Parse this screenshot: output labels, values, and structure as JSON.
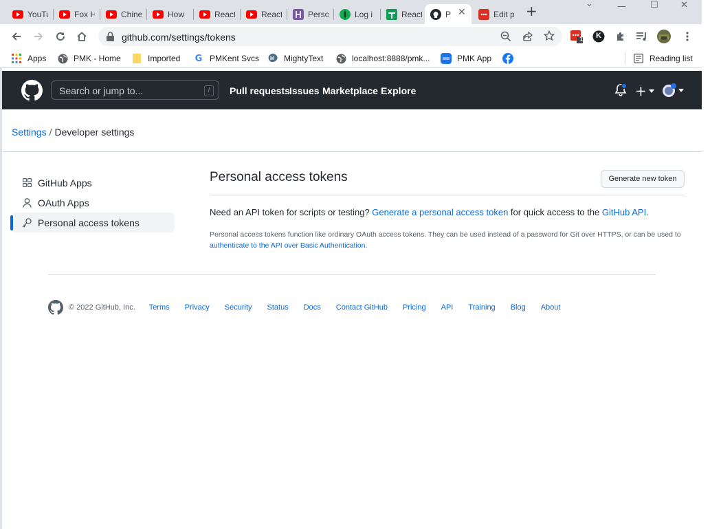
{
  "browser": {
    "tabs": [
      {
        "title": "YouTu",
        "icon": "youtube-icon"
      },
      {
        "title": "Fox H",
        "icon": "youtube-icon"
      },
      {
        "title": "Chine",
        "icon": "youtube-icon"
      },
      {
        "title": "How",
        "icon": "youtube-icon"
      },
      {
        "title": "React",
        "icon": "youtube-icon"
      },
      {
        "title": "React",
        "icon": "youtube-icon"
      },
      {
        "title": "Perso",
        "icon": "heroku-icon"
      },
      {
        "title": "Log i",
        "icon": "mongodb-icon"
      },
      {
        "title": "React",
        "icon": "google-sheets-icon"
      },
      {
        "title": "P",
        "icon": "github-icon",
        "active": true
      },
      {
        "title": "Edit p",
        "icon": "red-app-icon"
      }
    ],
    "url_host": "github.com",
    "url_path": "/settings/tokens",
    "bookmarks": [
      "Apps",
      "PMK - Home",
      "Imported",
      "PMKent Svcs",
      "MightyText",
      "localhost:8888/pmk...",
      "PMK App"
    ],
    "reading_list": "Reading list",
    "ext_badge": "1",
    "ext_k": "K"
  },
  "github": {
    "search_placeholder": "Search or jump to...",
    "search_key": "/",
    "nav": [
      "Pull requests",
      "Issues",
      "Marketplace",
      "Explore"
    ],
    "plus": "+"
  },
  "breadcrumb": {
    "root": "Settings",
    "sep": "/",
    "current": "Developer settings"
  },
  "sidebar": {
    "items": [
      {
        "label": "GitHub Apps",
        "icon": "apps-grid-icon"
      },
      {
        "label": "OAuth Apps",
        "icon": "person-icon"
      },
      {
        "label": "Personal access tokens",
        "icon": "key-icon",
        "selected": true
      }
    ]
  },
  "main": {
    "title": "Personal access tokens",
    "generate_button": "Generate new token",
    "lead_prefix": "Need an API token for scripts or testing? ",
    "lead_link": "Generate a personal access token",
    "lead_mid": " for quick access to the ",
    "lead_link2": "GitHub API",
    "lead_suffix": ".",
    "note_text": "Personal access tokens function like ordinary OAuth access tokens. They can be used instead of a password for Git over HTTPS, or can be used to ",
    "note_link": "authenticate to the API over Basic Authentication",
    "note_suffix": "."
  },
  "footer": {
    "copyright": "© 2022 GitHub, Inc.",
    "links": [
      "Terms",
      "Privacy",
      "Security",
      "Status",
      "Docs",
      "Contact GitHub",
      "Pricing",
      "API",
      "Training",
      "Blog",
      "About"
    ]
  },
  "colors": {
    "github_header": "#24292f",
    "link": "#0969da",
    "selected_bar": "#0969da"
  }
}
